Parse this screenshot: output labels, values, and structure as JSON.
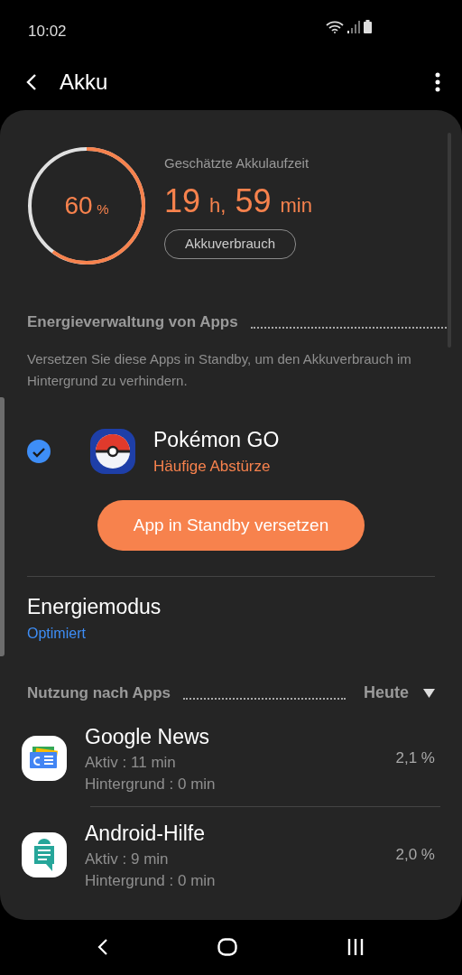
{
  "status_bar": {
    "time": "10:02"
  },
  "header": {
    "title": "Akku"
  },
  "battery": {
    "level": 0.6,
    "percent": "60",
    "percent_unit": "%",
    "estimate_label": "Geschätzte Akkulaufzeit",
    "hours": "19",
    "hours_unit": "h,",
    "minutes": "59",
    "minutes_unit": "min",
    "usage_button": "Akkuverbrauch"
  },
  "app_power": {
    "title": "Energieverwaltung von Apps",
    "description": "Versetzen Sie diese Apps in Standby, um den Akkuverbrauch im Hintergrund zu verhindern.",
    "apps": [
      {
        "name": "Pokémon GO",
        "issue": "Häufige Abstürze",
        "checked": true
      }
    ],
    "button": "App in Standby versetzen"
  },
  "power_mode": {
    "title": "Energiemodus",
    "value": "Optimiert"
  },
  "usage": {
    "title": "Nutzung nach Apps",
    "period": "Heute",
    "apps": [
      {
        "name": "Google News",
        "active": "Aktiv : 11 min",
        "background": "Hintergrund : 0 min",
        "share": "2,1 %"
      },
      {
        "name": "Android-Hilfe",
        "active": "Aktiv : 9 min",
        "background": "Hintergrund : 0 min",
        "share": "2,0 %"
      }
    ]
  }
}
